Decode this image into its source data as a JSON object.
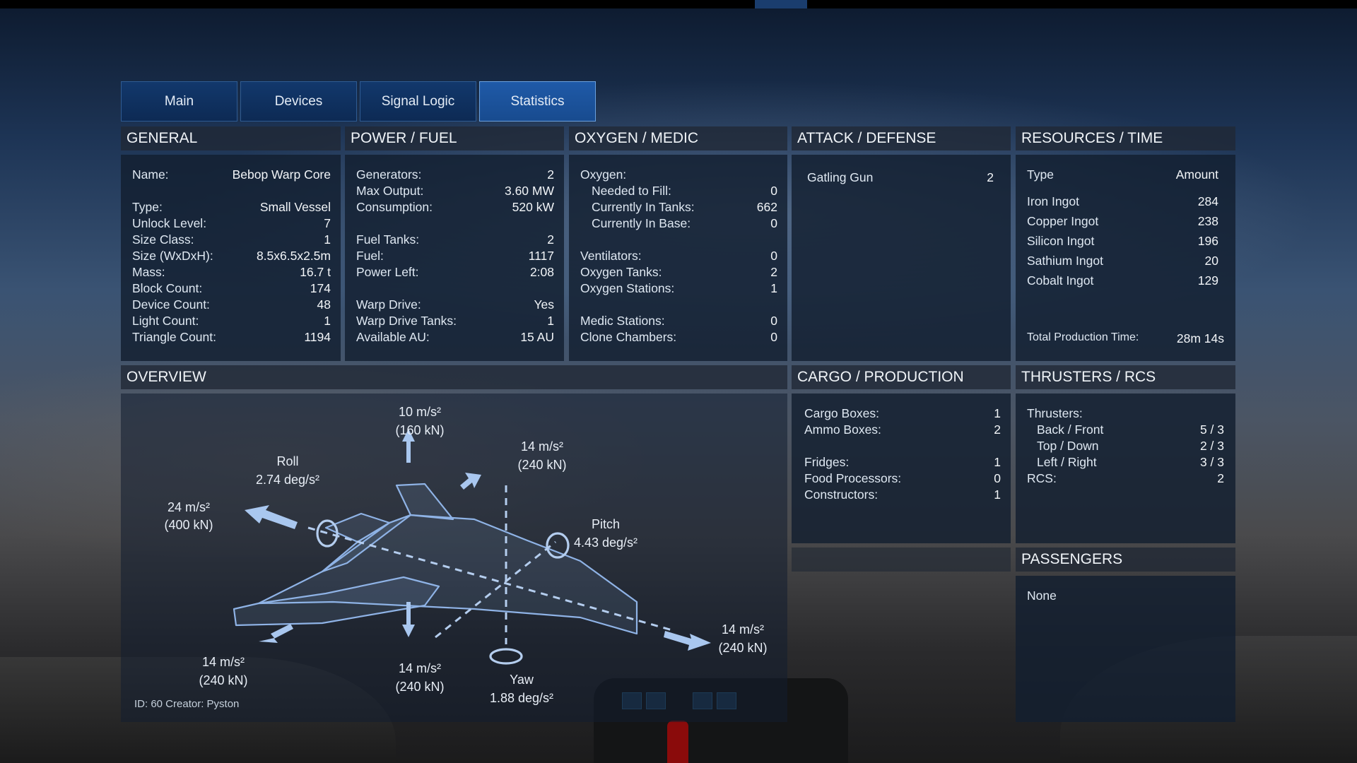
{
  "tabs": [
    {
      "label": "Main",
      "active": false
    },
    {
      "label": "Devices",
      "active": false
    },
    {
      "label": "Signal Logic",
      "active": false
    },
    {
      "label": "Statistics",
      "active": true
    }
  ],
  "general": {
    "title": "GENERAL",
    "rows": [
      {
        "k": "Name:",
        "v": "Bebop Warp Core"
      },
      {
        "k": "Type:",
        "v": "Small Vessel"
      },
      {
        "k": "Unlock Level:",
        "v": "7"
      },
      {
        "k": "Size Class:",
        "v": "1"
      },
      {
        "k": "Size (WxDxH):",
        "v": "8.5x6.5x2.5m"
      },
      {
        "k": "Mass:",
        "v": "16.7 t"
      },
      {
        "k": "Block Count:",
        "v": "174"
      },
      {
        "k": "Device Count:",
        "v": "48"
      },
      {
        "k": "Light Count:",
        "v": "1"
      },
      {
        "k": "Triangle Count:",
        "v": "1194"
      }
    ]
  },
  "power": {
    "title": "POWER / FUEL",
    "rows": [
      {
        "k": "Generators:",
        "v": "2"
      },
      {
        "k": "Max Output:",
        "v": "3.60 MW"
      },
      {
        "k": "Consumption:",
        "v": "520 kW"
      },
      {
        "k": "Fuel Tanks:",
        "v": "2"
      },
      {
        "k": "Fuel:",
        "v": "1117"
      },
      {
        "k": "Power Left:",
        "v": "2:08"
      },
      {
        "k": "Warp Drive:",
        "v": "Yes"
      },
      {
        "k": "Warp Drive Tanks:",
        "v": "1"
      },
      {
        "k": "Available AU:",
        "v": "15 AU"
      }
    ]
  },
  "oxygen": {
    "title": "OXYGEN / MEDIC",
    "rows": [
      {
        "k": "Oxygen:",
        "v": ""
      },
      {
        "k": "Needed to Fill:",
        "v": "0"
      },
      {
        "k": "Currently In Tanks:",
        "v": "662"
      },
      {
        "k": "Currently In Base:",
        "v": "0"
      },
      {
        "k": "Ventilators:",
        "v": "0"
      },
      {
        "k": "Oxygen Tanks:",
        "v": "2"
      },
      {
        "k": "Oxygen Stations:",
        "v": "1"
      },
      {
        "k": "Medic Stations:",
        "v": "0"
      },
      {
        "k": "Clone Chambers:",
        "v": "0"
      }
    ]
  },
  "attack": {
    "title": "ATTACK / DEFENSE",
    "rows": [
      {
        "k": "Gatling Gun",
        "v": "2"
      }
    ]
  },
  "resources": {
    "title": "RESOURCES / TIME",
    "col_type": "Type",
    "col_amount": "Amount",
    "rows": [
      {
        "k": "Iron Ingot",
        "v": "284"
      },
      {
        "k": "Copper Ingot",
        "v": "238"
      },
      {
        "k": "Silicon Ingot",
        "v": "196"
      },
      {
        "k": "Sathium Ingot",
        "v": "20"
      },
      {
        "k": "Cobalt Ingot",
        "v": "129"
      }
    ],
    "total_label": "Total Production Time:",
    "total_value": "28m 14s"
  },
  "overview": {
    "title": "OVERVIEW",
    "up_accel": "10 m/s²",
    "up_force": "(160 kN)",
    "fwd_accel": "24 m/s²",
    "fwd_force": "(400 kN)",
    "ur_accel": "14 m/s²",
    "ur_force": "(240 kN)",
    "roll_label": "Roll",
    "roll_value": "2.74 deg/s²",
    "pitch_label": "Pitch",
    "pitch_value": "4.43 deg/s²",
    "yaw_label": "Yaw",
    "yaw_value": "1.88 deg/s²",
    "bl_accel": "14 m/s²",
    "bl_force": "(240 kN)",
    "down_accel": "14 m/s²",
    "down_force": "(240 kN)",
    "back_accel": "14 m/s²",
    "back_force": "(240 kN)",
    "footer": "ID: 60  Creator: Pyston"
  },
  "cargo": {
    "title": "CARGO / PRODUCTION",
    "rows": [
      {
        "k": "Cargo Boxes:",
        "v": "1"
      },
      {
        "k": "Ammo Boxes:",
        "v": "2"
      },
      {
        "k": "Fridges:",
        "v": "1"
      },
      {
        "k": "Food Processors:",
        "v": "0"
      },
      {
        "k": "Constructors:",
        "v": "1"
      }
    ]
  },
  "thrusters": {
    "title": "THRUSTERS / RCS",
    "rows": [
      {
        "k": "Thrusters:",
        "v": ""
      },
      {
        "k": "Back / Front",
        "v": "5 / 3"
      },
      {
        "k": "Top / Down",
        "v": "2 / 3"
      },
      {
        "k": "Left / Right",
        "v": "3 / 3"
      },
      {
        "k": "RCS:",
        "v": "2"
      }
    ]
  },
  "passengers": {
    "title": "PASSENGERS",
    "value": "None"
  },
  "colors": {
    "tab_active": "#1f5aa8",
    "tab": "#12386c",
    "panel": "#121e30",
    "diagram": "#8fb3e6"
  }
}
